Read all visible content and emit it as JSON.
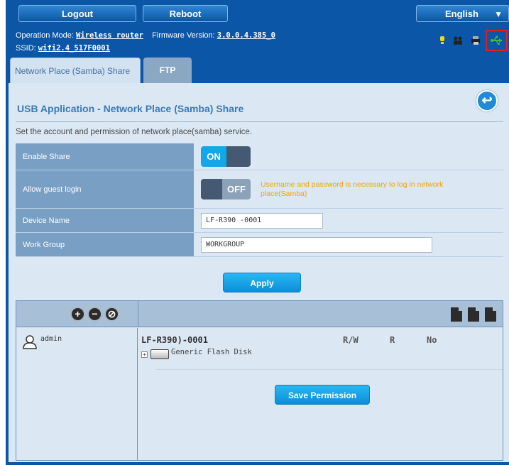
{
  "topbar": {
    "logout_label": "Logout",
    "reboot_label": "Reboot",
    "language": "English"
  },
  "status": {
    "mode_label": "Operation Mode:",
    "mode_value": "Wireless router",
    "firmware_label": "Firmware Version:",
    "firmware_value": "3.0.0.4.385_0",
    "ssid_label": "SSID:",
    "ssid_value": "wifi2.4_517F0001",
    "icons": [
      "lightbulb-icon",
      "users-icon",
      "printer-icon",
      "usb-icon"
    ],
    "usb_highlight_color": "#e02020"
  },
  "tabs": [
    {
      "label": "Network Place (Samba) Share",
      "active": true
    },
    {
      "label": "FTP Share",
      "active": false
    }
  ],
  "main": {
    "title": "USB Application - Network Place (Samba) Share",
    "description": "Set the account and permission of network place(samba) service.",
    "settings": {
      "enable_share_label": "Enable Share",
      "enable_share_state": "ON",
      "guest_login_label": "Allow guest login",
      "guest_login_state": "OFF",
      "guest_login_note": "Username and password is necessary to log in network place(Samba)",
      "device_name_label": "Device Name",
      "device_name_value": "LF-R390 -0001",
      "work_group_label": "Work Group",
      "work_group_value": "WORKGROUP"
    },
    "apply_label": "Apply"
  },
  "permissions": {
    "user": "admin",
    "device": "LF-R390)-0001",
    "columns": [
      "R/W",
      "R",
      "No"
    ],
    "disk": "Generic Flash Disk",
    "save_label": "Save Permission"
  },
  "colors": {
    "frame_blue": "#0b56a6",
    "panel_bg": "#dbe7f3",
    "label_bg": "#7a9fc4",
    "accent": "#12a7e8",
    "warning": "#f0a500"
  }
}
